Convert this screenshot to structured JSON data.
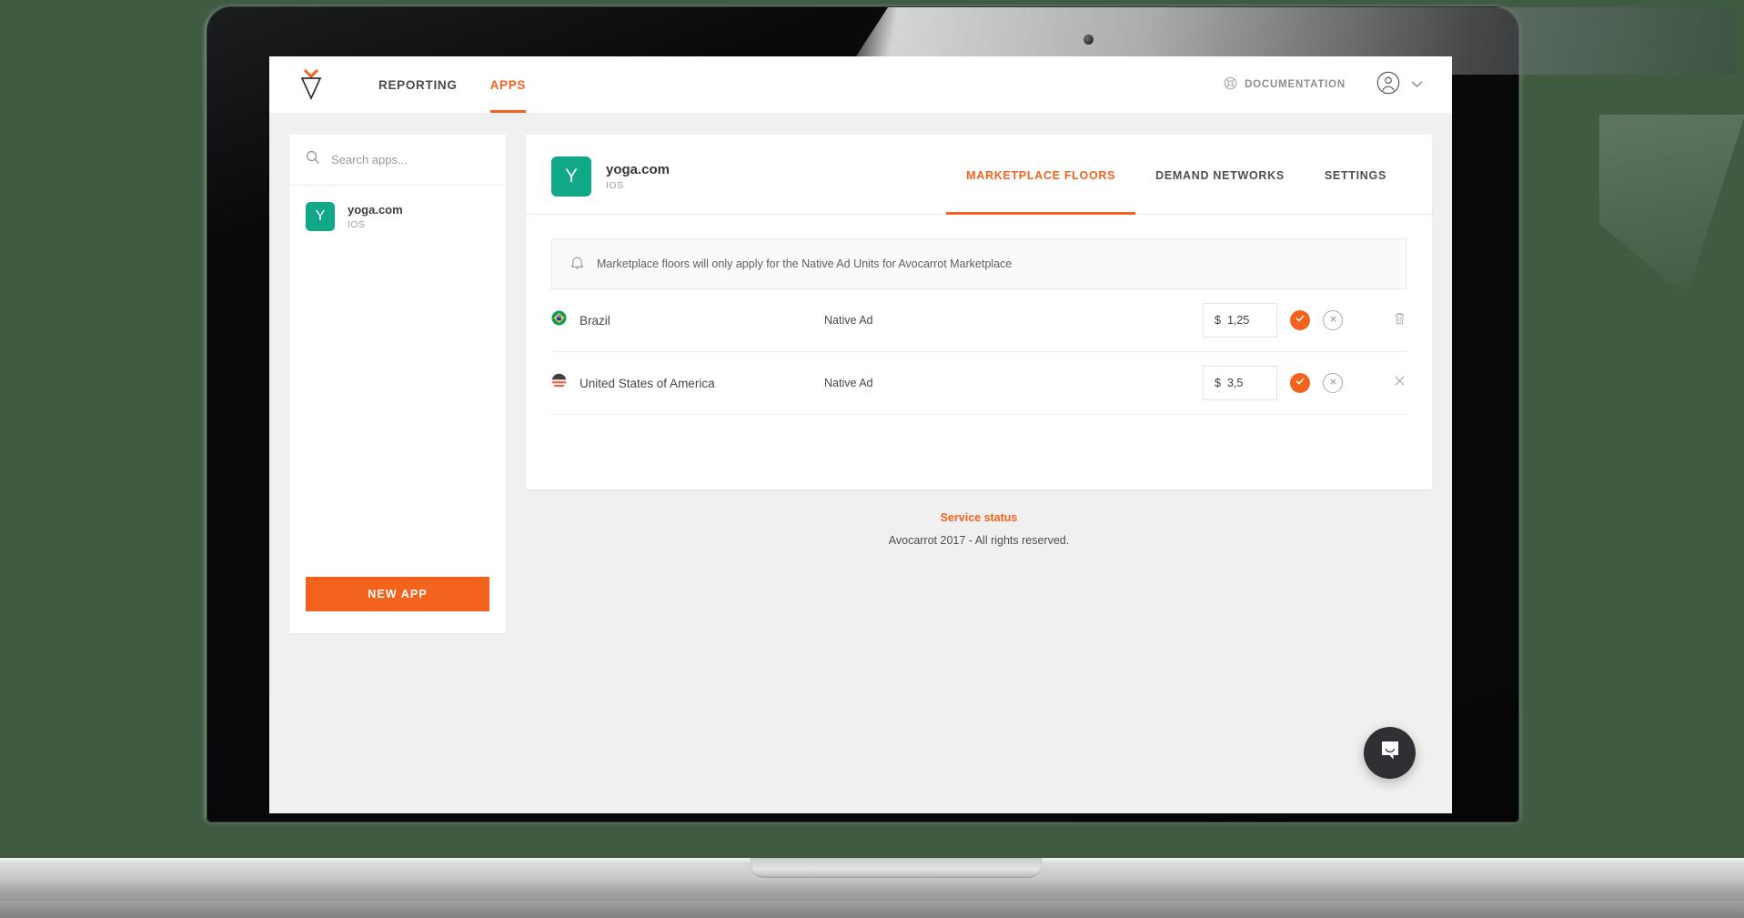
{
  "theme": {
    "accent": "#f4631e",
    "app_tile_color": "#10a887",
    "desktop_background": "#3f5c43"
  },
  "topnav": {
    "logo_name": "avocarrot-logo",
    "links": [
      {
        "label": "REPORTING",
        "active": false
      },
      {
        "label": "APPS",
        "active": true
      }
    ],
    "documentation_label": "DOCUMENTATION",
    "documentation_icon": "lifebuoy-icon",
    "avatar_icon": "user-avatar-icon",
    "account_chevron_icon": "chevron-down-icon"
  },
  "sidebar": {
    "search": {
      "icon": "search-icon",
      "value": "",
      "placeholder": "Search apps..."
    },
    "apps": [
      {
        "initial": "Y",
        "name": "yoga.com",
        "platform": "IOS",
        "selected": true
      }
    ],
    "new_app_label": "NEW APP"
  },
  "main": {
    "app": {
      "initial": "Y",
      "name": "yoga.com",
      "platform": "IOS"
    },
    "tabs": [
      {
        "label": "MARKETPLACE FLOORS",
        "active": true
      },
      {
        "label": "DEMAND NETWORKS",
        "active": false
      },
      {
        "label": "SETTINGS",
        "active": false
      }
    ],
    "notice": {
      "icon": "bell-icon",
      "text": "Marketplace floors will only apply for the Native Ad Units for Avocarrot Marketplace"
    },
    "floors": [
      {
        "flag_icon": "flag-brazil-icon",
        "country": "Brazil",
        "ad_type": "Native Ad",
        "currency": "$",
        "price": "1,25",
        "confirm_icon": "check-icon",
        "cancel_icon": "close-circle-icon",
        "remove_icon": "trash-icon"
      },
      {
        "flag_icon": "flag-usa-icon",
        "country": "United States of America",
        "ad_type": "Native Ad",
        "currency": "$",
        "price": "3,5",
        "confirm_icon": "check-icon",
        "cancel_icon": "close-circle-icon",
        "remove_icon": "close-icon"
      }
    ]
  },
  "footer": {
    "service_status_label": "Service status",
    "copyright": "Avocarrot 2017 - All rights reserved."
  },
  "chat": {
    "launcher_icon": "chat-bubble-icon"
  }
}
